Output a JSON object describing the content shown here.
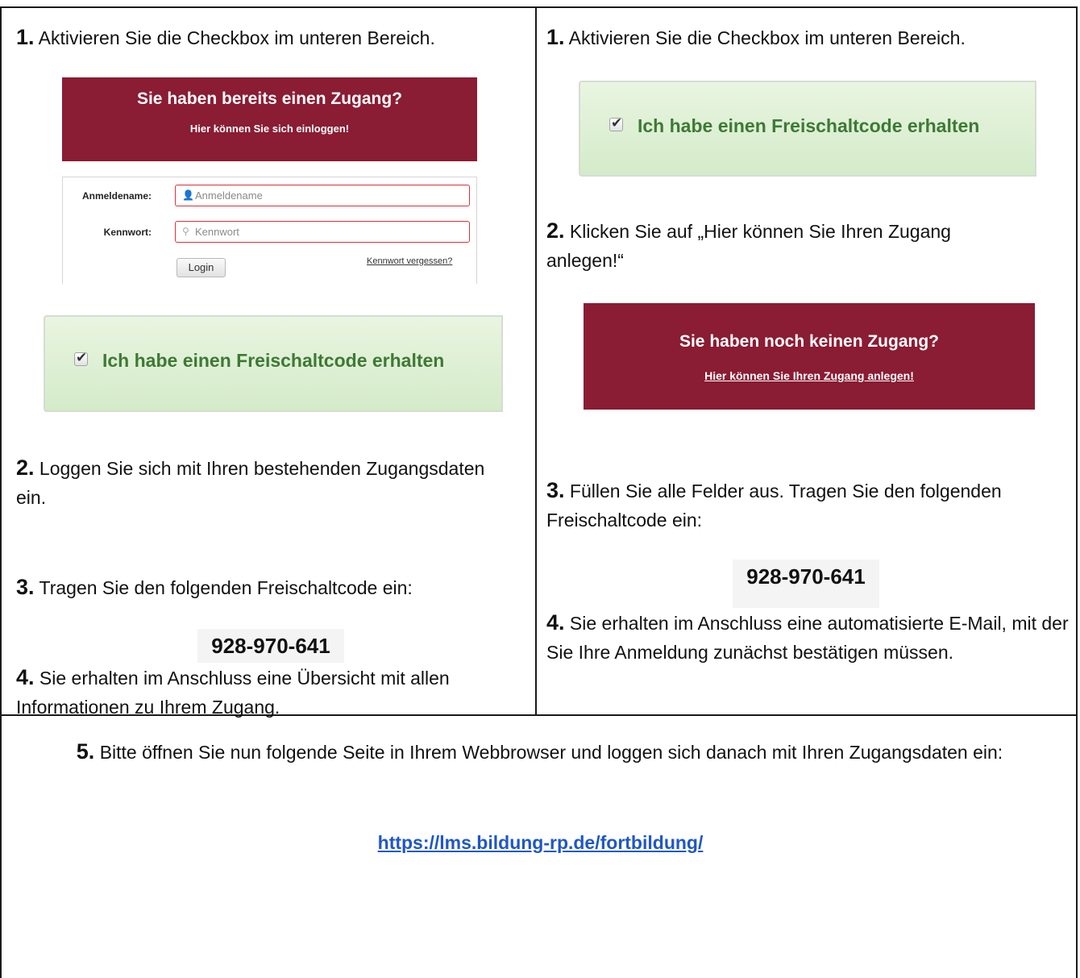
{
  "left": {
    "step1": {
      "num": "1.",
      "text": "Aktivieren Sie die Checkbox im unteren Bereich."
    },
    "login_banner": {
      "title": "Sie haben bereits einen Zugang?",
      "subtitle": "Hier können Sie sich einloggen!"
    },
    "login_form": {
      "username_label": "Anmeldename:",
      "username_placeholder": "Anmeldename",
      "password_label": "Kennwort:",
      "password_placeholder": "Kennwort",
      "login_button": "Login",
      "forgot_link": "Kennwort vergessen?"
    },
    "checkbox_label": "Ich habe einen Freischaltcode erhalten",
    "step2": {
      "num": "2.",
      "text": "Loggen Sie sich mit Ihren bestehenden Zugangsdaten ein."
    },
    "step3": {
      "num": "3.",
      "text": "Tragen Sie den folgenden Freischaltcode ein:"
    },
    "code": "928-970-641",
    "step4": {
      "num": "4.",
      "text": "Sie erhalten im Anschluss eine Übersicht mit allen Informationen zu Ihrem Zugang."
    }
  },
  "right": {
    "step1": {
      "num": "1.",
      "text": "Aktivieren Sie die Checkbox im unteren Bereich."
    },
    "checkbox_label": "Ich habe einen Freischaltcode erhalten",
    "step2": {
      "num": "2.",
      "text": "Klicken Sie auf „Hier können Sie Ihren Zugang anlegen!“"
    },
    "register_banner": {
      "title": "Sie haben noch keinen Zugang?",
      "link": "Hier können Sie Ihren Zugang anlegen!"
    },
    "step3": {
      "num": "3.",
      "text": "Füllen Sie alle Felder aus. Tragen Sie den folgenden Freischaltcode ein:"
    },
    "code": "928-970-641",
    "step4": {
      "num": "4.",
      "text": "Sie erhalten im Anschluss eine automatisierte E-Mail, mit der Sie Ihre Anmeldung zunächst bestätigen müssen."
    }
  },
  "footer": {
    "num": "5.",
    "text": "Bitte öffnen Sie nun folgende Seite in Ihrem Webbrowser und loggen sich danach mit Ihren Zugangsdaten ein:",
    "url": "https://lms.bildung-rp.de/fortbildung/"
  },
  "colors": {
    "banner": "#8a1c33",
    "green_label": "#3d7a34",
    "link": "#1f57c8",
    "input_border": "#d8313f"
  }
}
